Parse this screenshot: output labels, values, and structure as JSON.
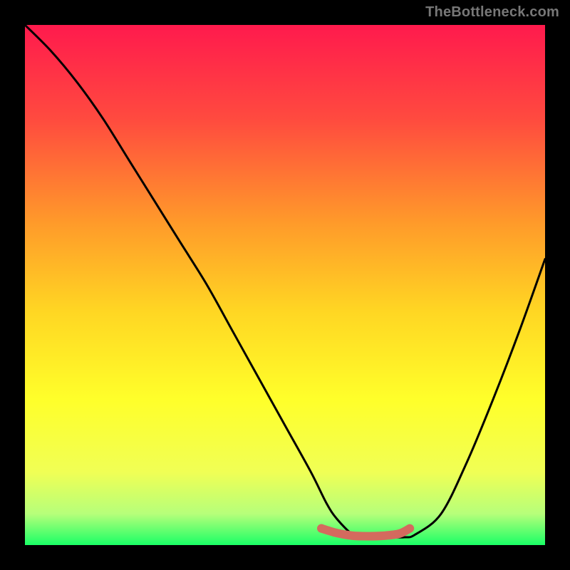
{
  "watermark": "TheBottleneck.com",
  "gradient": {
    "stops": [
      {
        "pos": 0,
        "color": "#ff1a4d"
      },
      {
        "pos": 0.18,
        "color": "#ff4a3f"
      },
      {
        "pos": 0.38,
        "color": "#ff9a2a"
      },
      {
        "pos": 0.55,
        "color": "#ffd623"
      },
      {
        "pos": 0.72,
        "color": "#ffff2a"
      },
      {
        "pos": 0.86,
        "color": "#f0ff55"
      },
      {
        "pos": 0.94,
        "color": "#b6ff7a"
      },
      {
        "pos": 1,
        "color": "#1aff66"
      }
    ]
  },
  "colors": {
    "curve": "#000000",
    "highlight": "#d46a5e"
  },
  "chart_data": {
    "type": "line",
    "title": "",
    "xlabel": "",
    "ylabel": "",
    "xlim": [
      0,
      100
    ],
    "ylim": [
      0,
      100
    ],
    "series": [
      {
        "name": "bottleneck-curve",
        "x": [
          0,
          5,
          10,
          15,
          20,
          25,
          30,
          35,
          40,
          45,
          50,
          55,
          58,
          60,
          63,
          65,
          68,
          70,
          73,
          75,
          80,
          85,
          90,
          95,
          100
        ],
        "y": [
          100,
          95,
          89,
          82,
          74,
          66,
          58,
          50,
          41,
          32,
          23,
          14,
          8,
          5,
          2,
          1.5,
          1.5,
          1.5,
          1.5,
          2,
          6,
          16,
          28,
          41,
          55
        ]
      }
    ],
    "highlight_segment": {
      "description": "emphasized valley segment",
      "x": [
        57,
        60,
        63,
        66,
        69,
        72,
        74
      ],
      "y": [
        3.2,
        2.3,
        1.8,
        1.7,
        1.8,
        2.2,
        3.2
      ]
    }
  }
}
